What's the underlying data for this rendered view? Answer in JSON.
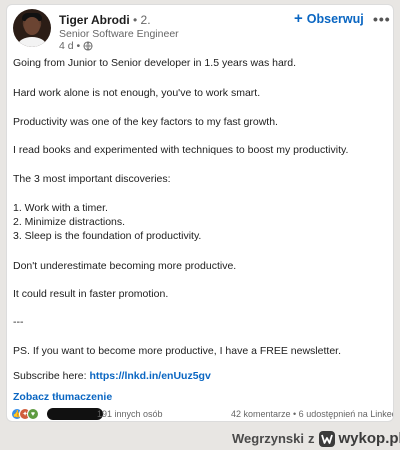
{
  "post": {
    "author_name": "Tiger Abrodi",
    "degree": " • 2.",
    "headline": "Senior Software Engineer",
    "time": "4 d •",
    "visibility_icon": "globe-icon",
    "follow_label": "Obserwuj",
    "follow_icon": "plus-icon",
    "more_icon": "more-icon",
    "paragraphs": [
      "Going from Junior to Senior developer in 1.5 years was hard.",
      "Hard work alone is not enough, you've to work smart.",
      "Productivity was one of the key factors to my fast growth.",
      "I read books and experimented with techniques to boost my productivity.",
      "The 3 most important discoveries:",
      "1. Work with a timer.",
      "2. Minimize distractions.",
      "3. Sleep is the foundation of productivity.",
      "Don't underestimate becoming more productive.",
      "It could result in faster promotion.",
      "---",
      "PS. If you want to become more productive, I have a FREE newsletter."
    ],
    "subscribe_label": "Subscribe here: ",
    "subscribe_link": "https://lnkd.in/enUuz5gv",
    "translate_label": "Zobacz tłumaczenie"
  },
  "footer": {
    "reaction_count": "191 innych osób",
    "comments_shares": "42 komentarze • 6 udostępnień na LinkedIn"
  },
  "watermark": {
    "user": "Wegrzynski",
    "connector": "z",
    "site": "wykop.pl"
  },
  "colors": {
    "accent": "#0a66c2",
    "text": "#1d1d1d",
    "muted": "#666666"
  }
}
